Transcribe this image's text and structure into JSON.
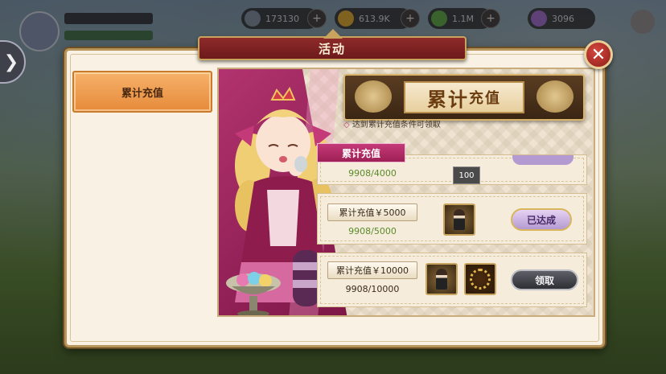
{
  "hud": {
    "player_level": "",
    "currency_1": "173130",
    "currency_2": "613.9K",
    "currency_3": "1.1M",
    "currency_4": "3096"
  },
  "window": {
    "title": "活动"
  },
  "tabs": [
    {
      "label": "累计充值",
      "active": true
    }
  ],
  "banner": {
    "title_big": "累计",
    "title_small": "充值",
    "condition": "达到累计充值条件可领取"
  },
  "section_tag": "累计充值",
  "rows": [
    {
      "requirement": "",
      "progress": "9908/4000",
      "item_count": "100",
      "status": ""
    },
    {
      "requirement": "累计充值￥5000",
      "progress": "9908/5000",
      "status": "已达成"
    },
    {
      "requirement": "累计充值￥10000",
      "progress": "9908/10000",
      "status": "领取"
    }
  ],
  "colors": {
    "accent": "#e68a3a",
    "title_red": "#6d1a1b",
    "pink": "#b2336f",
    "progress_green": "#5a8a2a"
  },
  "icons": [
    "close-icon",
    "chevron-right-icon",
    "character-icon",
    "ring-icon"
  ]
}
